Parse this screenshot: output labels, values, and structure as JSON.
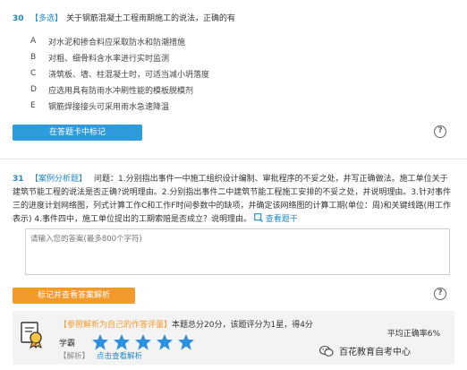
{
  "q30": {
    "number": "30",
    "type": "【多选】",
    "text": "关于钢筋混凝土工程雨期施工的说法，正确的有",
    "options": [
      {
        "letter": "A",
        "text": "对水泥和掺合料应采取防水和防潮措施"
      },
      {
        "letter": "B",
        "text": "对粗、细骨料含水率进行实时监测"
      },
      {
        "letter": "C",
        "text": "浇筑板、墙、柱混凝土时，可适当减小坍落度"
      },
      {
        "letter": "D",
        "text": "应选用具有防雨水冲刷性能的模板脱模剂"
      },
      {
        "letter": "E",
        "text": "钢筋焊接接头可采用雨水急速降温"
      }
    ],
    "mark_button": "在答题卡中标记"
  },
  "q31": {
    "number": "31",
    "type": "【案例分析题】",
    "text": "问题：1.分别指出事件一中施工组织设计编制、审批程序的不妥之处，并写正确做法。施工单位关于建筑节能工程的说法是否正确?说明理由。2.分别指出事件二中建筑节能工程施工安排的不妥之处，并说明理由。3.针对事件三的进度计划网络图，列式计算工作C和工作F时间参数中的缺项，并确定该网络图的计算工期(单位：周)和关键线路(用工作表示) 4.事件四中，施工单位提出的工期索赔是否成立？说明理由。",
    "view_question": "查看题干",
    "answer_placeholder": "请输入您的答案(最多800个字符)",
    "submit_button": "标记并查看答案解析"
  },
  "result_panel": {
    "ref_prefix": "【参照解析为自己的作答评量】",
    "ref_text": "本题总分20分，该题评分为1星，得4分",
    "level_label": "学霸",
    "stars": 5,
    "analysis_tag": "【解析】",
    "analysis_link": "点击查看解析",
    "accuracy": "平均正确率6%"
  },
  "watermark": "百花教育自考中心",
  "colors": {
    "accent_blue": "#1e88c8",
    "button_blue": "#2d9bdd",
    "button_orange": "#f39a2b",
    "star_blue": "#2d8fe0"
  },
  "icons": {
    "help": "question-circle-icon",
    "search": "search-icon",
    "seal": "exam-seal-icon",
    "watermark": "wechat-icon"
  }
}
